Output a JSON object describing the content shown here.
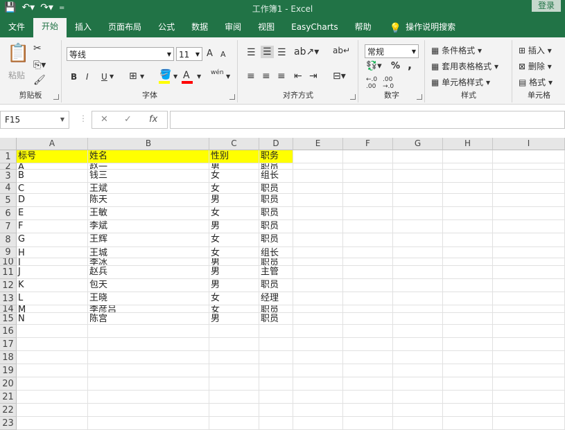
{
  "app": {
    "title": "工作簿1  -  Excel",
    "login": "登录"
  },
  "tabs": [
    "文件",
    "开始",
    "插入",
    "页面布局",
    "公式",
    "数据",
    "审阅",
    "视图",
    "EasyCharts",
    "帮助",
    "操作说明搜索"
  ],
  "active_tab": "开始",
  "ribbon": {
    "clipboard": {
      "paste": "粘贴",
      "label": "剪贴板"
    },
    "font": {
      "name": "等线",
      "size": "11",
      "grow": "A",
      "shrink": "A",
      "bold": "B",
      "italic": "I",
      "underline": "U",
      "phonetic": "wén",
      "label": "字体",
      "fill_color": "#ffff00",
      "font_color": "#ff0000"
    },
    "alignment": {
      "label": "对齐方式"
    },
    "number": {
      "format": "常规",
      "percent": "%",
      "comma": ",",
      "label": "数字"
    },
    "styles": {
      "conditional": "条件格式",
      "table": "套用表格格式",
      "cell": "单元格样式",
      "label": "样式"
    },
    "cells": {
      "insert": "插入",
      "delete": "删除",
      "format": "格式",
      "label": "单元格"
    }
  },
  "formula_bar": {
    "name_box": "F15",
    "fx": "fx",
    "value": ""
  },
  "sheet": {
    "columns": [
      "A",
      "B",
      "C",
      "D",
      "E",
      "F",
      "G",
      "H",
      "I"
    ],
    "row_numbers": [
      "1",
      "2",
      "3",
      "4",
      "5",
      "6",
      "7",
      "8",
      "9",
      "10",
      "11",
      "12",
      "13",
      "14",
      "15",
      "16",
      "17",
      "18",
      "19",
      "20",
      "21",
      "22",
      "23"
    ],
    "header_fill": "#ffff00",
    "rows": [
      [
        "标号",
        "姓名",
        "性别",
        "职务"
      ],
      [
        "A",
        "赵一",
        "男",
        "职员"
      ],
      [
        "B",
        "钱三",
        "女",
        "组长"
      ],
      [
        "C",
        "王斌",
        "女",
        "职员"
      ],
      [
        "D",
        "陈天",
        "男",
        "职员"
      ],
      [
        "E",
        "王敏",
        "女",
        "职员"
      ],
      [
        "F",
        "李斌",
        "男",
        "职员"
      ],
      [
        "G",
        "王辉",
        "女",
        "职员"
      ],
      [
        "H",
        "王城",
        "女",
        "组长"
      ],
      [
        "I",
        "李冰",
        "男",
        "职员"
      ],
      [
        "J",
        "赵兵",
        "男",
        "主管"
      ],
      [
        "K",
        "包天",
        "男",
        "职员"
      ],
      [
        "L",
        "王晓",
        "女",
        "经理"
      ],
      [
        "M",
        "李彦吕",
        "女",
        "职员"
      ],
      [
        "N",
        "陈宫",
        "男",
        "职员"
      ]
    ]
  }
}
